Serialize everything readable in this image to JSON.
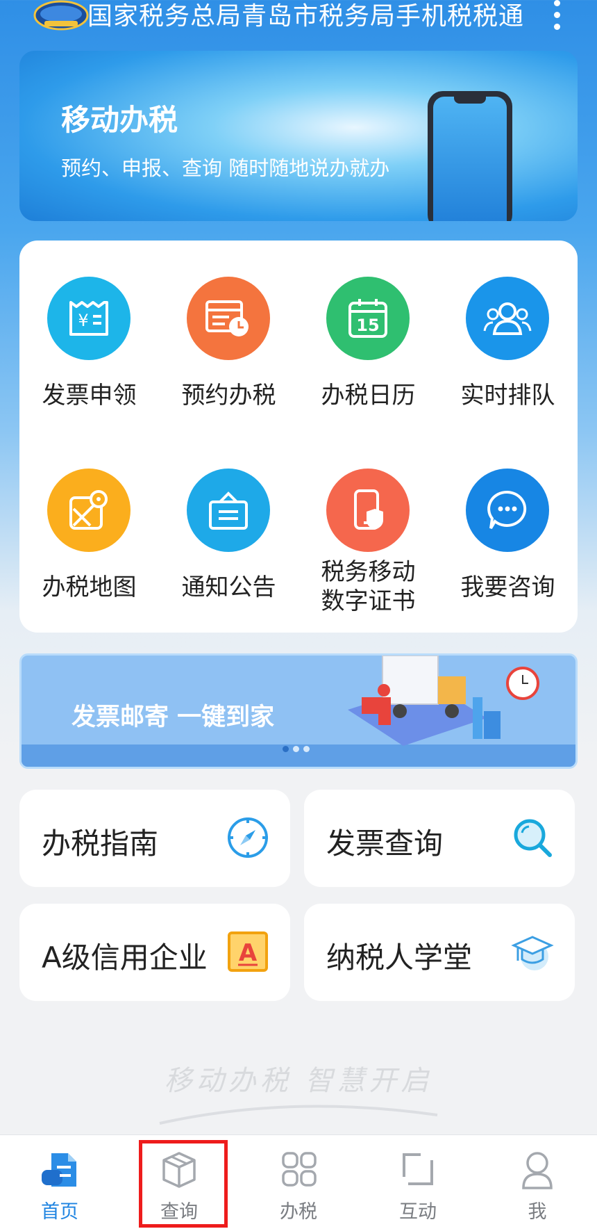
{
  "header": {
    "title": "国家税务总局青岛市税务局手机税税通"
  },
  "banner": {
    "title": "移动办税",
    "subtitle": "预约、申报、查询 随时随地说办就办"
  },
  "services": [
    {
      "label": "发票申领",
      "icon": "invoice-yen-icon",
      "color": "#1db5e9"
    },
    {
      "label": "预约办税",
      "icon": "appointment-clock-icon",
      "color": "#f4743e"
    },
    {
      "label": "办税日历",
      "icon": "calendar-15-icon",
      "color": "#2fbf70"
    },
    {
      "label": "实时排队",
      "icon": "people-queue-icon",
      "color": "#1a95ea"
    },
    {
      "label": "办税地图",
      "icon": "map-pin-icon",
      "color": "#fbae1d"
    },
    {
      "label": "通知公告",
      "icon": "notice-bag-icon",
      "color": "#1ea9e8"
    },
    {
      "label": "税务移动\n数字证书",
      "icon": "phone-shield-icon",
      "color": "#f5674d"
    },
    {
      "label": "我要咨询",
      "icon": "chat-bubble-icon",
      "color": "#1786e4"
    }
  ],
  "calendar_day": "15",
  "promo": {
    "text": "发票邮寄  一键到家",
    "slides": 3,
    "active_slide": 1
  },
  "quick_links": [
    {
      "label": "办税指南",
      "icon": "compass-icon"
    },
    {
      "label": "发票查询",
      "icon": "magnifier-icon"
    },
    {
      "label": "A级信用企业",
      "icon": "credit-a-icon",
      "badge": "A"
    },
    {
      "label": "纳税人学堂",
      "icon": "graduation-cap-icon"
    }
  ],
  "slogan": "移动办税  智慧开启",
  "tabbar": [
    {
      "label": "首页",
      "icon": "home-document-icon",
      "active": true
    },
    {
      "label": "查询",
      "icon": "cube-icon",
      "active": false
    },
    {
      "label": "办税",
      "icon": "four-squares-icon",
      "active": false
    },
    {
      "label": "互动",
      "icon": "interact-bracket-icon",
      "active": false
    },
    {
      "label": "我",
      "icon": "person-icon",
      "active": false
    }
  ],
  "colors": {
    "primary": "#1f84e1",
    "highlight_box": "#ee1c1c",
    "tab_inactive": "#7a7d82"
  }
}
